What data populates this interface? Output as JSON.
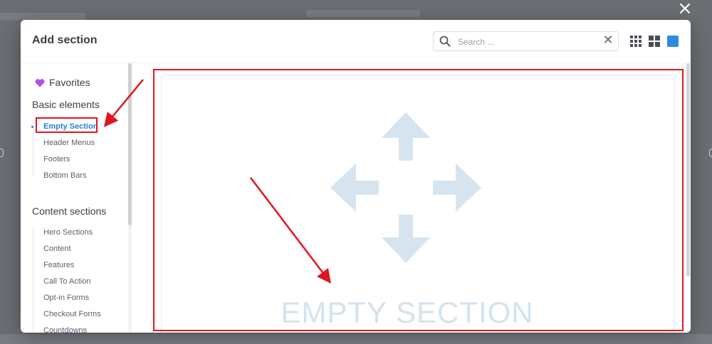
{
  "modal": {
    "title": "Add section",
    "search": {
      "placeholder": "Search ..."
    },
    "view_icons": [
      "grid-small-icon",
      "grid-large-icon",
      "single-view-icon"
    ],
    "accent_color": "#2a7fd4"
  },
  "sidebar": {
    "favorites_label": "Favorites",
    "groups": [
      {
        "title": "Basic elements",
        "items": [
          "Empty Section",
          "Header Menus",
          "Footers",
          "Bottom Bars"
        ]
      },
      {
        "title": "Content sections",
        "items": [
          "Hero Sections",
          "Content",
          "Features",
          "Call To Action",
          "Opt-in Forms",
          "Checkout Forms",
          "Countdowns"
        ]
      }
    ],
    "active_item": "Empty Section"
  },
  "main": {
    "card_label": "EMPTY SECTION"
  },
  "annotations": {
    "highlight_color": "#e0161e"
  }
}
